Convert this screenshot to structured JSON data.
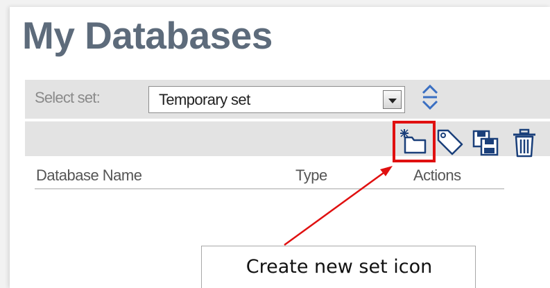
{
  "page": {
    "title": "My Databases"
  },
  "set_selector": {
    "label": "Select set:",
    "selected_value": "Temporary set",
    "sort_icon": "up-down-sort-icon"
  },
  "toolbar": {
    "icons": [
      "create-new-set-icon",
      "tag-icon",
      "save-icon",
      "delete-icon"
    ],
    "highlighted": "create-new-set-icon",
    "highlight_color": "#e01010"
  },
  "table": {
    "columns": [
      "Database Name",
      "Type",
      "Actions"
    ],
    "rows": []
  },
  "annotation": {
    "text": "Create new set icon",
    "color": "#e01010"
  }
}
